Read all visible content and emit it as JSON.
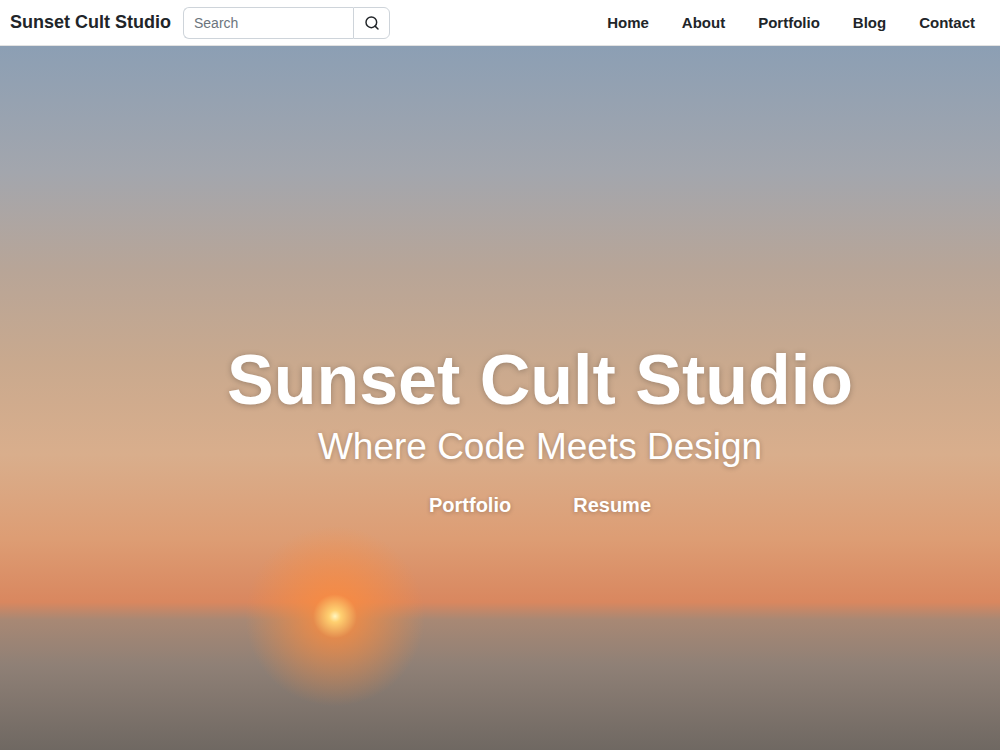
{
  "navbar": {
    "brand": "Sunset Cult Studio",
    "search": {
      "placeholder": "Search"
    },
    "links": [
      {
        "label": "Home"
      },
      {
        "label": "About"
      },
      {
        "label": "Portfolio"
      },
      {
        "label": "Blog"
      },
      {
        "label": "Contact"
      }
    ]
  },
  "hero": {
    "title": "Sunset Cult Studio",
    "subtitle": "Where Code Meets Design",
    "buttons": [
      {
        "label": "Portfolio"
      },
      {
        "label": "Resume"
      }
    ]
  }
}
